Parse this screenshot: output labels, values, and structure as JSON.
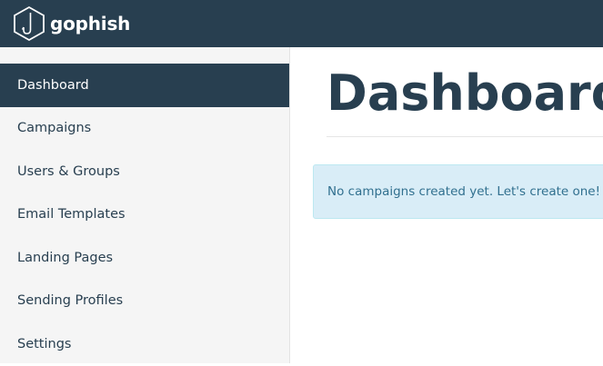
{
  "brand": {
    "name": "gophish",
    "icon": "hexagon-hook-icon"
  },
  "sidebar": {
    "items": [
      {
        "label": "Dashboard",
        "active": true
      },
      {
        "label": "Campaigns"
      },
      {
        "label": "Users & Groups"
      },
      {
        "label": "Email Templates"
      },
      {
        "label": "Landing Pages"
      },
      {
        "label": "Sending Profiles"
      },
      {
        "label": "Settings"
      }
    ]
  },
  "main": {
    "title": "Dashboard",
    "alert": "No campaigns created yet. Let's create one!"
  },
  "colors": {
    "navbar": "#283f50",
    "sidebar_bg": "#f5f5f5",
    "alert_bg": "#d9edf7",
    "alert_text": "#31708f"
  }
}
